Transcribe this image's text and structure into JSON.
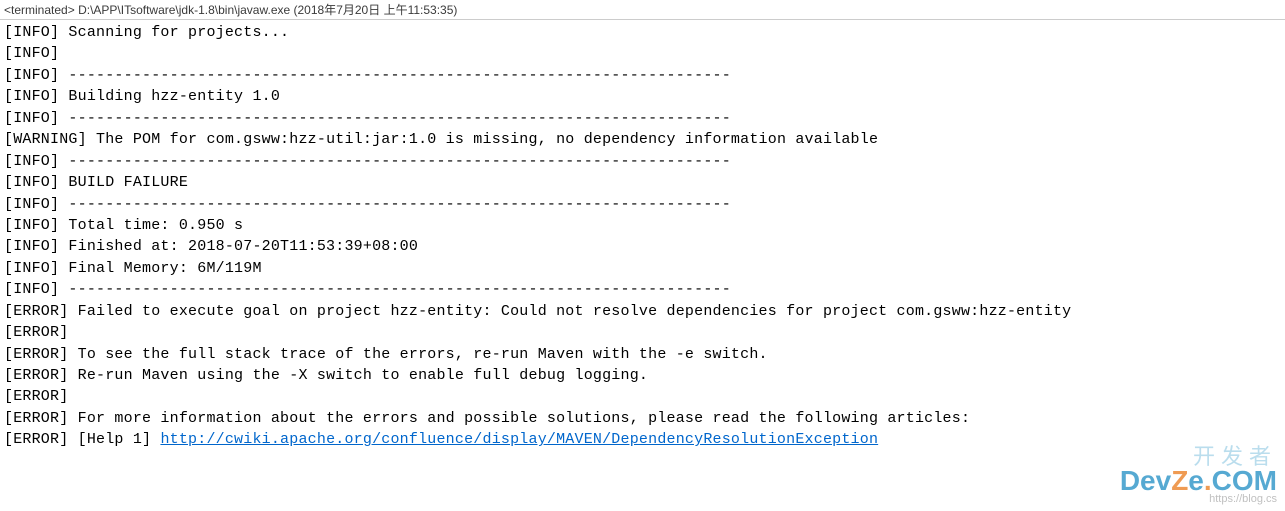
{
  "header": {
    "status": "<terminated>",
    "path": "D:\\APP\\ITsoftware\\jdk-1.8\\bin\\javaw.exe",
    "timestamp": "(2018年7月20日 上午11:53:35)"
  },
  "separator": "------------------------------------------------------------------------",
  "lines": [
    {
      "level": "[INFO]",
      "msg": " Scanning for projects..."
    },
    {
      "level": "[INFO]",
      "msg": ""
    },
    {
      "level": "[INFO]",
      "msg": " ",
      "sep": true
    },
    {
      "level": "[INFO]",
      "msg": " Building hzz-entity 1.0"
    },
    {
      "level": "[INFO]",
      "msg": " ",
      "sep": true
    },
    {
      "level": "[WARNING]",
      "msg": " The POM for com.gsww:hzz-util:jar:1.0 is missing, no dependency information available"
    },
    {
      "level": "[INFO]",
      "msg": " ",
      "sep": true
    },
    {
      "level": "[INFO]",
      "msg": " BUILD FAILURE"
    },
    {
      "level": "[INFO]",
      "msg": " ",
      "sep": true
    },
    {
      "level": "[INFO]",
      "msg": " Total time: 0.950 s"
    },
    {
      "level": "[INFO]",
      "msg": " Finished at: 2018-07-20T11:53:39+08:00"
    },
    {
      "level": "[INFO]",
      "msg": " Final Memory: 6M/119M"
    },
    {
      "level": "[INFO]",
      "msg": " ",
      "sep": true
    },
    {
      "level": "[ERROR]",
      "msg": " Failed to execute goal on project hzz-entity: Could not resolve dependencies for project com.gsww:hzz-entity"
    },
    {
      "level": "[ERROR]",
      "msg": ""
    },
    {
      "level": "[ERROR]",
      "msg": " To see the full stack trace of the errors, re-run Maven with the -e switch."
    },
    {
      "level": "[ERROR]",
      "msg": " Re-run Maven using the -X switch to enable full debug logging."
    },
    {
      "level": "[ERROR]",
      "msg": ""
    },
    {
      "level": "[ERROR]",
      "msg": " For more information about the errors and possible solutions, please read the following articles:"
    },
    {
      "level": "[ERROR]",
      "msg": " [Help 1] ",
      "link": "http://cwiki.apache.org/confluence/display/MAVEN/DependencyResolutionException"
    }
  ],
  "watermark": {
    "top": "开发者",
    "main_dev": "Dev",
    "main_z": "Z",
    "main_e": "e",
    "main_dot": ".",
    "main_c": "C",
    "main_om": "oM",
    "sub": "https://blog.cs"
  }
}
